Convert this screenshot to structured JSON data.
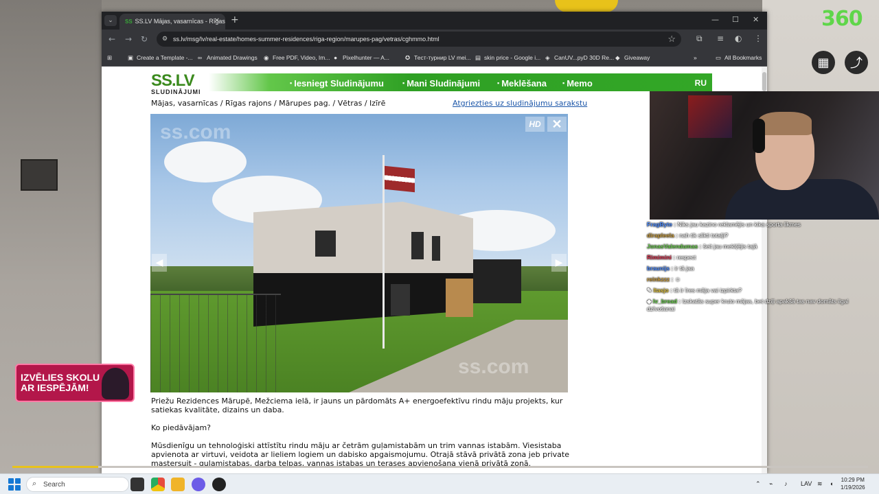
{
  "stream": {
    "logo": "360",
    "promo_text": "IZVĒLIES SKOLU AR IESPĒJĀM!",
    "progress_fraction": 0.1,
    "chat": [
      {
        "user": "FragByte",
        "color": "#4b8bff",
        "text": "Niks jau kazino reklamējis un kika sporta likmes"
      },
      {
        "user": "dirapleela",
        "color": "#c79a3b",
        "text": "nah tik slikti totalji?"
      },
      {
        "user": "JonasValendumas",
        "color": "#6ccf4f",
        "text": "šeit jau mekl(ējis tajā"
      },
      {
        "user": "Rimimini",
        "color": "#d9304c",
        "text": "respect"
      },
      {
        "user": "braunijs",
        "color": "#4b8bff",
        "text": "ir tā jaa"
      },
      {
        "user": "reinkzzz",
        "color": "#c79a3b",
        "text": ""
      },
      {
        "user": "Itasjo",
        "color": "#e0c23a",
        "text": "tā ir īres māja vai izpirkta?"
      },
      {
        "user": "lv_bread",
        "color": "#6ccf4f",
        "text": "Izskatās super kruto mājas, bet dziļi apakšā tas nav domāts ilgai dzīvošanai"
      }
    ]
  },
  "browser": {
    "tab_title": "SS.LV Mājas, vasarnīcas - Rīgas",
    "tab_favicon": "SS",
    "url": "ss.lv/msg/lv/real-estate/homes-summer-residences/riga-region/marupes-pag/vetras/cghmmo.html",
    "bookmarks": [
      "Create a Template -...",
      "Animated Drawings",
      "Free PDF, Video, Im...",
      "Pixelhunter — A...",
      "Тест-турнир LV mei...",
      "skin price - Google i...",
      "CanUV...pyD 30D Re...",
      "Giveaway"
    ],
    "all_bookmarks": "All Bookmarks"
  },
  "site": {
    "logo_big": "SS.LV",
    "logo_small": "SLUDINĀJUMI",
    "nav": [
      "Iesniegt Sludinājumu",
      "Mani Sludinājumi",
      "Meklēšana",
      "Memo"
    ],
    "lang": "RU",
    "breadcrumb": "Mājas, vasarnīcas / Rīgas rajons / Mārupes pag. / Vētras / Izīrē",
    "back_link": "Atgriezties uz sludinājumu sarakstu",
    "photo_badges": {
      "hd": "HD",
      "close": "✕"
    },
    "watermark": "ss.com",
    "description": [
      "Priežu Rezidences Mārupē, Mežciema ielā, ir jauns un pārdomāts A+ energoefektīvu rindu māju projekts, kur satiekas kvalitāte, dizains un daba.",
      "Ko piedāvājam?",
      "Mūsdienīgu un tehnoloģiski attīstītu rindu māju ar četrām guļamistabām un trim vannas istabām. Viesistaba apvienota ar virtuvi, veidota ar lieliem logiem un dabisko apgaismojumu. Otrajā stāvā privātā zona jeb private mastersuit - guļamistabas, darba telpas, vannas istabas un terases apvienošana vienā privātā zonā."
    ]
  },
  "taskbar": {
    "search_placeholder": "Search",
    "lang": "LAV",
    "time": "10:29 PM",
    "date": "1/19/2026"
  }
}
